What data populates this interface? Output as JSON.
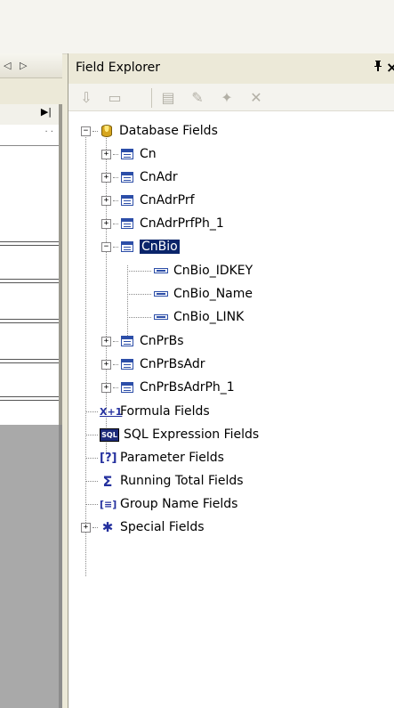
{
  "left_pane": {
    "nav_prev": "◁",
    "nav_next": "▷",
    "nav_last": "▶|",
    "ruler_dots": "·  ·"
  },
  "panel": {
    "title": "Field Explorer",
    "pin": "ᵽ",
    "close": "×"
  },
  "toolbar": {
    "insert": "⇩",
    "browse": "▭",
    "new": "▤",
    "edit": "✎",
    "rename": "✦",
    "delete": "✕"
  },
  "tree": {
    "database_fields": {
      "label": "Database Fields",
      "tables": [
        {
          "label": "Cn"
        },
        {
          "label": "CnAdr"
        },
        {
          "label": "CnAdrPrf"
        },
        {
          "label": "CnAdrPrfPh_1"
        },
        {
          "label": "CnBio",
          "fields": [
            "CnBio_IDKEY",
            "CnBio_Name",
            "CnBio_LINK"
          ]
        },
        {
          "label": "CnPrBs"
        },
        {
          "label": "CnPrBsAdr"
        },
        {
          "label": "CnPrBsAdrPh_1"
        }
      ]
    },
    "formula_fields": {
      "label": "Formula Fields",
      "icon": "X+1"
    },
    "sql_expression_fields": {
      "label": "SQL Expression Fields",
      "icon": "SQL"
    },
    "parameter_fields": {
      "label": "Parameter Fields",
      "icon": "[?]"
    },
    "running_total_fields": {
      "label": "Running Total Fields",
      "icon": "Σ"
    },
    "group_name_fields": {
      "label": "Group Name Fields",
      "icon": "[≡]"
    },
    "special_fields": {
      "label": "Special Fields",
      "icon": "✱"
    }
  }
}
